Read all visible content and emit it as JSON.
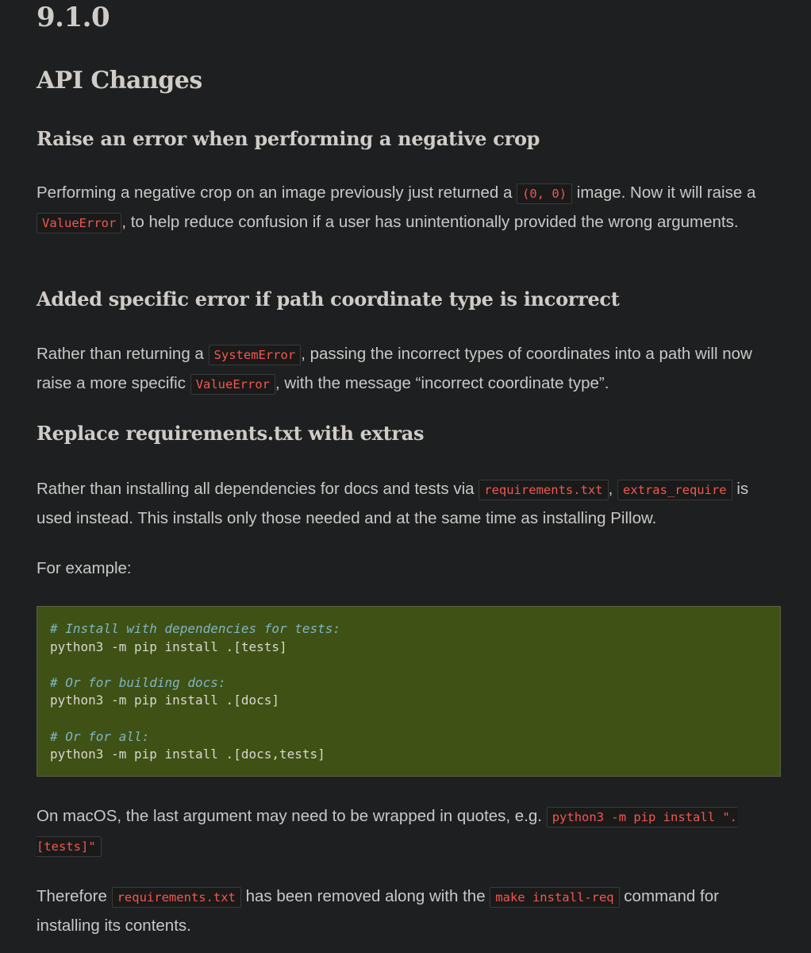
{
  "version_title": "9.1.0",
  "section_title": "API Changes",
  "sections": [
    {
      "heading": "Raise an error when performing a negative crop",
      "para": {
        "t1": "Performing a negative crop on an image previously just returned a ",
        "c1": "(0, 0)",
        "t2": " image. Now it will raise a ",
        "c2": "ValueError",
        "t3": ", to help reduce confusion if a user has unintentionally provided the wrong arguments."
      }
    },
    {
      "heading": "Added specific error if path coordinate type is incorrect",
      "para": {
        "t1": "Rather than returning a ",
        "c1": "SystemError",
        "t2": ", passing the incorrect types of coordinates into a path will now raise a more specific ",
        "c2": "ValueError",
        "t3": ", with the message “incorrect coordinate type”."
      }
    },
    {
      "heading": "Replace requirements.txt with extras",
      "para": {
        "t1": "Rather than installing all dependencies for docs and tests via ",
        "c1": "requirements.txt",
        "t2": ", ",
        "c2": "extras_require",
        "t3": " is used instead. This installs only those needed and at the same time as installing Pillow."
      },
      "example_label": "For example:",
      "code_lines": [
        {
          "comment": "# Install with dependencies for tests:",
          "cmd": "python3 -m pip install .[tests]"
        },
        {
          "comment": "# Or for building docs:",
          "cmd": "python3 -m pip install .[docs]"
        },
        {
          "comment": "# Or for all:",
          "cmd": "python3 -m pip install .[docs,tests]"
        }
      ],
      "macos_para": {
        "t1": "On macOS, the last argument may need to be wrapped in quotes, e.g. ",
        "c1": "python3 -m pip install \".[tests]\""
      },
      "therefore_para": {
        "t1": "Therefore ",
        "c1": "requirements.txt",
        "t2": " has been removed along with the ",
        "c2": "make install-req",
        "t3": " command for installing its contents."
      }
    }
  ]
}
